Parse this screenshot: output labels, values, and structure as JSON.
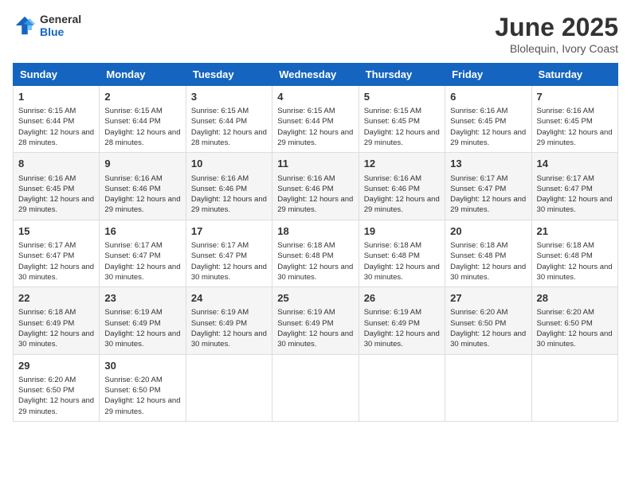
{
  "logo": {
    "line1": "General",
    "line2": "Blue"
  },
  "title": "June 2025",
  "subtitle": "Blolequin, Ivory Coast",
  "days": [
    "Sunday",
    "Monday",
    "Tuesday",
    "Wednesday",
    "Thursday",
    "Friday",
    "Saturday"
  ],
  "weeks": [
    [
      {
        "day": "1",
        "sunrise": "6:15 AM",
        "sunset": "6:44 PM",
        "daylight": "12 hours and 28 minutes."
      },
      {
        "day": "2",
        "sunrise": "6:15 AM",
        "sunset": "6:44 PM",
        "daylight": "12 hours and 28 minutes."
      },
      {
        "day": "3",
        "sunrise": "6:15 AM",
        "sunset": "6:44 PM",
        "daylight": "12 hours and 28 minutes."
      },
      {
        "day": "4",
        "sunrise": "6:15 AM",
        "sunset": "6:44 PM",
        "daylight": "12 hours and 29 minutes."
      },
      {
        "day": "5",
        "sunrise": "6:15 AM",
        "sunset": "6:45 PM",
        "daylight": "12 hours and 29 minutes."
      },
      {
        "day": "6",
        "sunrise": "6:16 AM",
        "sunset": "6:45 PM",
        "daylight": "12 hours and 29 minutes."
      },
      {
        "day": "7",
        "sunrise": "6:16 AM",
        "sunset": "6:45 PM",
        "daylight": "12 hours and 29 minutes."
      }
    ],
    [
      {
        "day": "8",
        "sunrise": "6:16 AM",
        "sunset": "6:45 PM",
        "daylight": "12 hours and 29 minutes."
      },
      {
        "day": "9",
        "sunrise": "6:16 AM",
        "sunset": "6:46 PM",
        "daylight": "12 hours and 29 minutes."
      },
      {
        "day": "10",
        "sunrise": "6:16 AM",
        "sunset": "6:46 PM",
        "daylight": "12 hours and 29 minutes."
      },
      {
        "day": "11",
        "sunrise": "6:16 AM",
        "sunset": "6:46 PM",
        "daylight": "12 hours and 29 minutes."
      },
      {
        "day": "12",
        "sunrise": "6:16 AM",
        "sunset": "6:46 PM",
        "daylight": "12 hours and 29 minutes."
      },
      {
        "day": "13",
        "sunrise": "6:17 AM",
        "sunset": "6:47 PM",
        "daylight": "12 hours and 29 minutes."
      },
      {
        "day": "14",
        "sunrise": "6:17 AM",
        "sunset": "6:47 PM",
        "daylight": "12 hours and 30 minutes."
      }
    ],
    [
      {
        "day": "15",
        "sunrise": "6:17 AM",
        "sunset": "6:47 PM",
        "daylight": "12 hours and 30 minutes."
      },
      {
        "day": "16",
        "sunrise": "6:17 AM",
        "sunset": "6:47 PM",
        "daylight": "12 hours and 30 minutes."
      },
      {
        "day": "17",
        "sunrise": "6:17 AM",
        "sunset": "6:47 PM",
        "daylight": "12 hours and 30 minutes."
      },
      {
        "day": "18",
        "sunrise": "6:18 AM",
        "sunset": "6:48 PM",
        "daylight": "12 hours and 30 minutes."
      },
      {
        "day": "19",
        "sunrise": "6:18 AM",
        "sunset": "6:48 PM",
        "daylight": "12 hours and 30 minutes."
      },
      {
        "day": "20",
        "sunrise": "6:18 AM",
        "sunset": "6:48 PM",
        "daylight": "12 hours and 30 minutes."
      },
      {
        "day": "21",
        "sunrise": "6:18 AM",
        "sunset": "6:48 PM",
        "daylight": "12 hours and 30 minutes."
      }
    ],
    [
      {
        "day": "22",
        "sunrise": "6:18 AM",
        "sunset": "6:49 PM",
        "daylight": "12 hours and 30 minutes."
      },
      {
        "day": "23",
        "sunrise": "6:19 AM",
        "sunset": "6:49 PM",
        "daylight": "12 hours and 30 minutes."
      },
      {
        "day": "24",
        "sunrise": "6:19 AM",
        "sunset": "6:49 PM",
        "daylight": "12 hours and 30 minutes."
      },
      {
        "day": "25",
        "sunrise": "6:19 AM",
        "sunset": "6:49 PM",
        "daylight": "12 hours and 30 minutes."
      },
      {
        "day": "26",
        "sunrise": "6:19 AM",
        "sunset": "6:49 PM",
        "daylight": "12 hours and 30 minutes."
      },
      {
        "day": "27",
        "sunrise": "6:20 AM",
        "sunset": "6:50 PM",
        "daylight": "12 hours and 30 minutes."
      },
      {
        "day": "28",
        "sunrise": "6:20 AM",
        "sunset": "6:50 PM",
        "daylight": "12 hours and 30 minutes."
      }
    ],
    [
      {
        "day": "29",
        "sunrise": "6:20 AM",
        "sunset": "6:50 PM",
        "daylight": "12 hours and 29 minutes."
      },
      {
        "day": "30",
        "sunrise": "6:20 AM",
        "sunset": "6:50 PM",
        "daylight": "12 hours and 29 minutes."
      },
      null,
      null,
      null,
      null,
      null
    ]
  ],
  "labels": {
    "sunrise": "Sunrise:",
    "sunset": "Sunset:",
    "daylight": "Daylight:"
  }
}
